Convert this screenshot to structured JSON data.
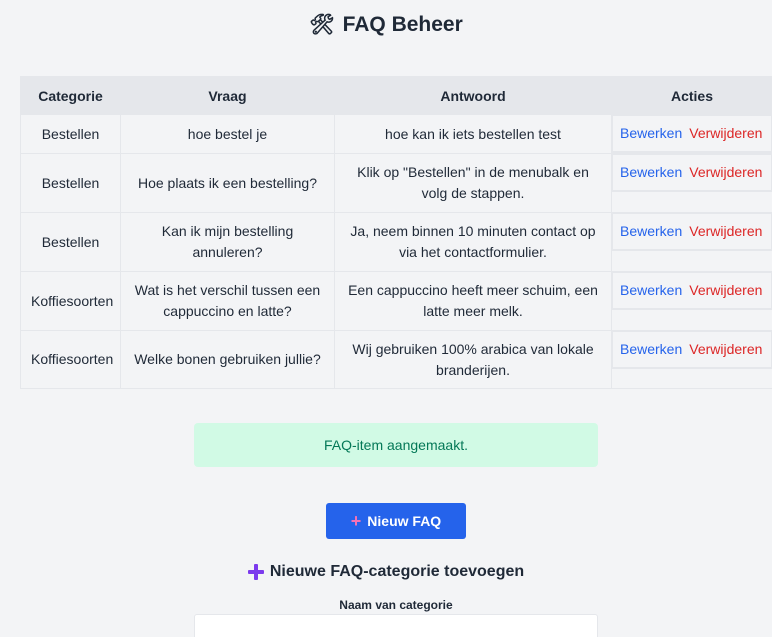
{
  "page": {
    "title": "FAQ Beheer",
    "title_icon": "tools-icon"
  },
  "table": {
    "headers": [
      "Categorie",
      "Vraag",
      "Antwoord",
      "Acties"
    ],
    "rows": [
      {
        "category": "Bestellen",
        "question": "hoe bestel je",
        "answer": "hoe kan ik iets bestellen test",
        "edit": "Bewerken",
        "delete": "Verwijderen"
      },
      {
        "category": "Bestellen",
        "question": "Hoe plaats ik een bestelling?",
        "answer": "Klik op \"Bestellen\" in de menubalk en volg de stappen.",
        "edit": "Bewerken",
        "delete": "Verwijderen"
      },
      {
        "category": "Bestellen",
        "question": "Kan ik mijn bestelling annuleren?",
        "answer": "Ja, neem binnen 10 minuten contact op via het contactformulier.",
        "edit": "Bewerken",
        "delete": "Verwijderen"
      },
      {
        "category": "Koffiesoorten",
        "question": "Wat is het verschil tussen een cappuccino en latte?",
        "answer": "Een cappuccino heeft meer schuim, een latte meer melk.",
        "edit": "Bewerken",
        "delete": "Verwijderen"
      },
      {
        "category": "Koffiesoorten",
        "question": "Welke bonen gebruiken jullie?",
        "answer": "Wij gebruiken 100% arabica van lokale branderijen.",
        "edit": "Bewerken",
        "delete": "Verwijderen"
      }
    ]
  },
  "alert": {
    "message": "FAQ-item aangemaakt."
  },
  "new_faq_button": {
    "label": "Nieuw FAQ",
    "icon": "plus-icon"
  },
  "category_form": {
    "heading": "Nieuwe FAQ-categorie toevoegen",
    "heading_icon": "plus-icon",
    "name_label": "Naam van categorie",
    "name_value": ""
  },
  "colors": {
    "primary": "#2563eb",
    "danger": "#dc2626",
    "success_bg": "#d1fae5",
    "success_text": "#047857",
    "header_bg": "#e5e7eb",
    "page_bg": "#f3f4f6"
  }
}
